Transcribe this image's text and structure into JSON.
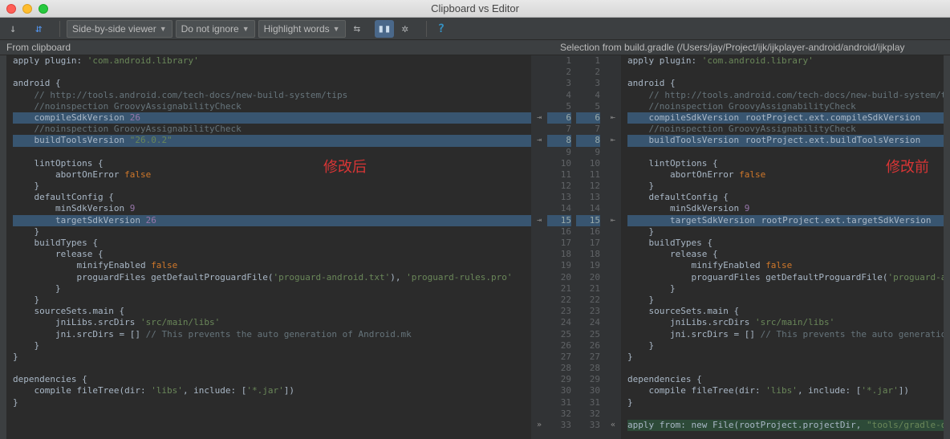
{
  "window": {
    "title": "Clipboard vs Editor"
  },
  "toolbar": {
    "viewer_mode": "Side-by-side viewer",
    "ignore_mode": "Do not ignore",
    "highlight_mode": "Highlight words"
  },
  "headers": {
    "left": "From clipboard",
    "right": "Selection from build.gradle (/Users/jay/Project/ijk/ijkplayer-android/android/ijkplay"
  },
  "annotations": {
    "left": "修改后",
    "right": "修改前"
  },
  "line_numbers": {
    "left": [
      "1",
      "2",
      "3",
      "4",
      "5",
      "6",
      "7",
      "8",
      "9",
      "10",
      "11",
      "12",
      "13",
      "14",
      "15",
      "16",
      "17",
      "18",
      "19",
      "20",
      "21",
      "22",
      "23",
      "24",
      "25",
      "26",
      "27",
      "28",
      "29",
      "30",
      "31",
      "32",
      "33"
    ],
    "right": [
      "1",
      "2",
      "3",
      "4",
      "5",
      "6",
      "7",
      "8",
      "9",
      "10",
      "11",
      "12",
      "13",
      "14",
      "15",
      "16",
      "17",
      "18",
      "19",
      "20",
      "21",
      "22",
      "23",
      "24",
      "25",
      "26",
      "27",
      "28",
      "29",
      "30",
      "31",
      "32",
      "33"
    ]
  },
  "diff_highlight_lines": [
    6,
    8,
    15
  ],
  "code_left": {
    "l1": {
      "pre": "apply plugin: ",
      "str": "'com.android.library'"
    },
    "l2": "",
    "l3": "android {",
    "l4": {
      "pre": "    ",
      "cmt": "// http://tools.android.com/tech-docs/new-build-system/tips"
    },
    "l5": {
      "pre": "    ",
      "cmt": "//noinspection GroovyAssignabilityCheck"
    },
    "l6": {
      "pre": "    compileSdkVersion ",
      "val": "26"
    },
    "l7": {
      "pre": "    ",
      "cmt": "//noinspection GroovyAssignabilityCheck"
    },
    "l8": {
      "pre": "    buildToolsVersion ",
      "str": "\"26.0.2\""
    },
    "l9": "",
    "l10": "    lintOptions {",
    "l11": {
      "pre": "        abortOnError ",
      "kw": "false"
    },
    "l12": "    }",
    "l13": "    defaultConfig {",
    "l14": {
      "pre": "        minSdkVersion ",
      "val": "9"
    },
    "l15": {
      "pre": "        targetSdkVersion ",
      "val": "26"
    },
    "l16": "    }",
    "l17": "    buildTypes {",
    "l18": "        release {",
    "l19": {
      "pre": "            minifyEnabled ",
      "kw": "false"
    },
    "l20": {
      "pre": "            proguardFiles getDefaultProguardFile(",
      "str": "'proguard-android.txt'",
      "post": "), ",
      "str2": "'proguard-rules.pro'"
    },
    "l21": "        }",
    "l22": "    }",
    "l23": "    sourceSets.main {",
    "l24": {
      "pre": "        jniLibs.srcDirs ",
      "str": "'src/main/libs'"
    },
    "l25": {
      "pre": "        jni.srcDirs = [] ",
      "cmt": "// This prevents the auto generation of Android.mk"
    },
    "l26": "    }",
    "l27": "}",
    "l28": "",
    "l29": "dependencies {",
    "l30": {
      "pre": "    compile fileTree(dir: ",
      "str": "'libs'",
      "post": ", include: [",
      "str2": "'*.jar'",
      "post2": "])"
    },
    "l31": "}",
    "l32": "",
    "l33": ""
  },
  "code_right": {
    "l1": {
      "pre": "apply plugin: ",
      "str": "'com.android.library'"
    },
    "l2": "",
    "l3": "android {",
    "l4": {
      "pre": "    ",
      "cmt": "// http://tools.android.com/tech-docs/new-build-system/tips"
    },
    "l5": {
      "pre": "    ",
      "cmt": "//noinspection GroovyAssignabilityCheck"
    },
    "l6": {
      "pre": "    compileSdkVersion ",
      "box": "rootProject.ext.compileSdkVersion"
    },
    "l7": {
      "pre": "    ",
      "cmt": "//noinspection GroovyAssignabilityCheck"
    },
    "l8": {
      "pre": "    buildToolsVersion ",
      "box": "rootProject.ext.buildToolsVersion"
    },
    "l9": "",
    "l10": "    lintOptions {",
    "l11": {
      "pre": "        abortOnError ",
      "kw": "false"
    },
    "l12": "    }",
    "l13": "    defaultConfig {",
    "l14": {
      "pre": "        minSdkVersion ",
      "val": "9"
    },
    "l15": {
      "pre": "        targetSdkVersion ",
      "box": "rootProject.ext.targetSdkVersion"
    },
    "l16": "    }",
    "l17": "    buildTypes {",
    "l18": "        release {",
    "l19": {
      "pre": "            minifyEnabled ",
      "kw": "false"
    },
    "l20": {
      "pre": "            proguardFiles getDefaultProguardFile(",
      "str": "'proguard-andro"
    },
    "l21": "        }",
    "l22": "    }",
    "l23": "    sourceSets.main {",
    "l24": {
      "pre": "        jniLibs.srcDirs ",
      "str": "'src/main/libs'"
    },
    "l25": {
      "pre": "        jni.srcDirs = [] ",
      "cmt": "// This prevents the auto generation of"
    },
    "l26": "    }",
    "l27": "}",
    "l28": "",
    "l29": "dependencies {",
    "l30": {
      "pre": "    compile fileTree(dir: ",
      "str": "'libs'",
      "post": ", include: [",
      "str2": "'*.jar'",
      "post2": "])"
    },
    "l31": "}",
    "l32": "",
    "l33": {
      "pre": "apply from: new File(rootProject.projectDir, ",
      "str": "\"tools/gradle-on-dem"
    }
  }
}
